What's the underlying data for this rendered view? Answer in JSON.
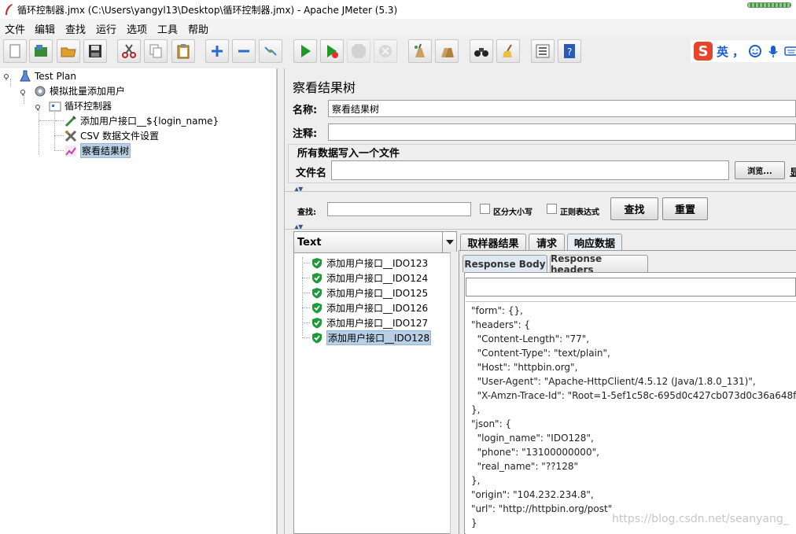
{
  "window": {
    "title": "循环控制器.jmx (C:\\Users\\yangyl13\\Desktop\\循环控制器.jmx) - Apache JMeter (5.3)"
  },
  "menu": [
    "文件",
    "编辑",
    "查找",
    "运行",
    "选项",
    "工具",
    "帮助"
  ],
  "toolbar": {
    "buttons": [
      "new-icon",
      "templates-icon",
      "open-icon",
      "save-icon",
      "cut-icon",
      "copy-icon",
      "paste-icon",
      "expand-icon",
      "collapse-icon",
      "toggle-icon",
      "start-icon",
      "start-no-pause-icon",
      "stop-icon",
      "shutdown-icon",
      "clear-icon",
      "clear-all-icon",
      "search-icon",
      "reset-search-icon",
      "function-helper-icon",
      "help-icon"
    ]
  },
  "ime": {
    "label": "英",
    "punct": "，"
  },
  "tree": {
    "items": [
      {
        "label": "Test Plan",
        "icon": "test-plan-icon"
      },
      {
        "label": "模拟批量添加用户",
        "icon": "thread-group-icon"
      },
      {
        "label": "循环控制器",
        "icon": "loop-controller-icon"
      },
      {
        "label": "添加用户接口__${login_name}",
        "icon": "http-sampler-icon"
      },
      {
        "label": "CSV 数据文件设置",
        "icon": "csv-config-icon"
      },
      {
        "label": "察看结果树",
        "icon": "listener-icon",
        "selected": true
      }
    ]
  },
  "panel": {
    "title": "察看结果树",
    "name_label": "名称:",
    "name_value": "察看结果树",
    "comment_label": "注释:",
    "comment_value": "",
    "file_group_title": "所有数据写入一个文件",
    "file_label": "文件名",
    "file_value": "",
    "browse_button": "浏览...",
    "cut_label": "显"
  },
  "search": {
    "label": "查找:",
    "value": "",
    "case_sensitive": "区分大小写",
    "regex": "正则表达式",
    "find_button": "查找",
    "reset_button": "重置"
  },
  "results": {
    "renderer": "Text",
    "items": [
      {
        "label": "添加用户接口__IDO123",
        "status": "success"
      },
      {
        "label": "添加用户接口__IDO124",
        "status": "success"
      },
      {
        "label": "添加用户接口__IDO125",
        "status": "success"
      },
      {
        "label": "添加用户接口__IDO126",
        "status": "success"
      },
      {
        "label": "添加用户接口__IDO127",
        "status": "success"
      },
      {
        "label": "添加用户接口__IDO128",
        "status": "success",
        "selected": true
      }
    ]
  },
  "tabs": [
    "取样器结果",
    "请求",
    "响应数据"
  ],
  "active_tab": "响应数据",
  "subtabs": [
    "Response Body",
    "Response headers"
  ],
  "active_subtab": "Response Body",
  "response_body": [
    "\"form\": {},",
    "\"headers\": {",
    "  \"Content-Length\": \"77\",",
    "  \"Content-Type\": \"text/plain\",",
    "  \"Host\": \"httpbin.org\",",
    "  \"User-Agent\": \"Apache-HttpClient/4.5.12 (Java/1.8.0_131)\",",
    "  \"X-Amzn-Trace-Id\": \"Root=1-5ef1c58c-695d0c427cb073d0c36a648f\"",
    "},",
    "\"json\": {",
    "  \"login_name\": \"IDO128\",",
    "  \"phone\": \"13100000000\",",
    "  \"real_name\": \"??128\"",
    "},",
    "\"origin\": \"104.232.234.8\",",
    "\"url\": \"http://httpbin.org/post\"",
    "}"
  ],
  "watermark": "https://blog.csdn.net/seanyang_",
  "colors": {
    "selection": "#b8cfe5",
    "success": "#1e9a3a",
    "run": "#1c9a24"
  }
}
